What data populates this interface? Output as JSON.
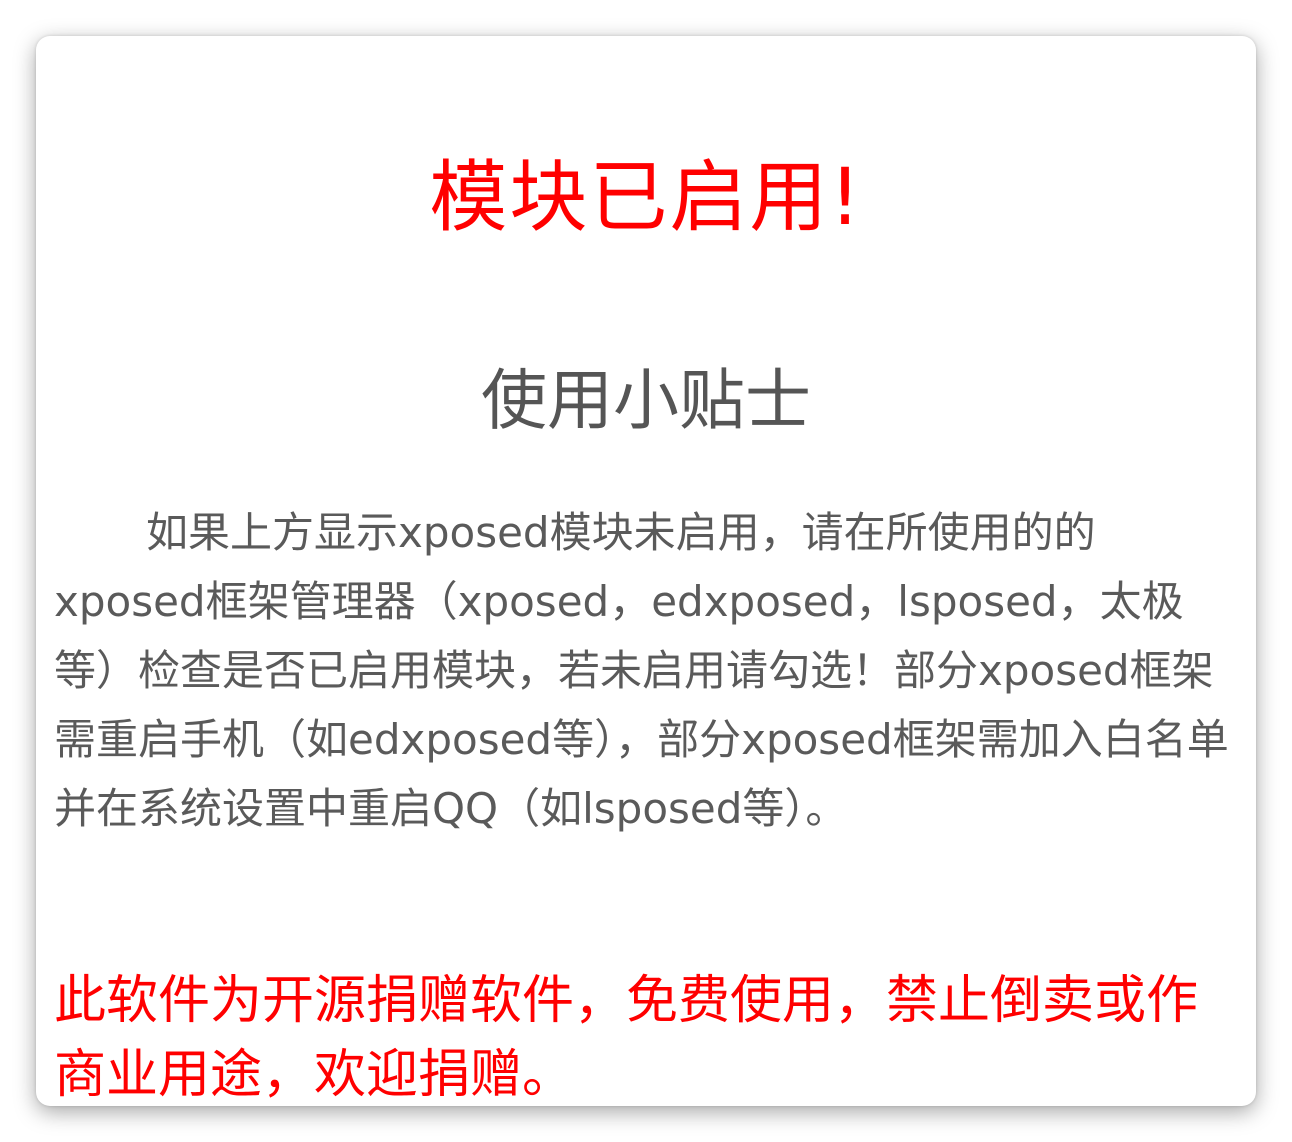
{
  "dialog": {
    "status_text": "模块已启用!",
    "status_color": "#ff0000",
    "tips_title": "使用小贴士",
    "tips_body": "如果上方显示xposed模块未启用，请在所使用的的xposed框架管理器（xposed，edxposed，lsposed，太极等）检查是否已启用模块，若未启用请勾选！部分xposed框架需重启手机（如edxposed等），部分xposed框架需加入白名单并在系统设置中重启QQ（如lsposed等）。",
    "notice_text": "此软件为开源捐赠软件，免费使用，禁止倒卖或作商业用途，欢迎捐赠。",
    "notice_color": "#ff0000"
  }
}
